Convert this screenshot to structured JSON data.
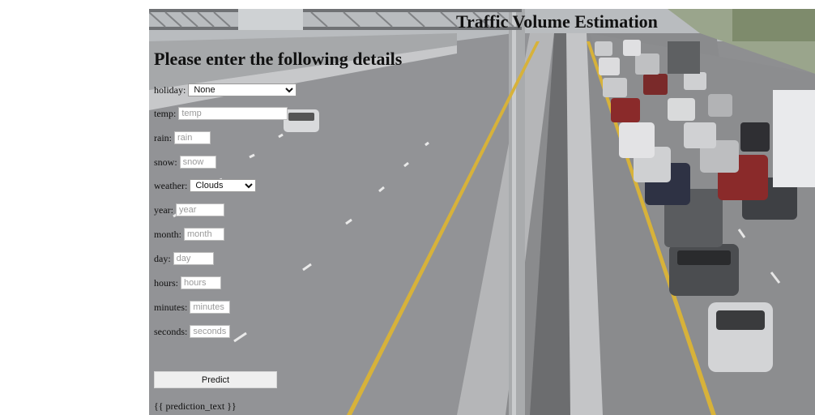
{
  "title": "Traffic Volume Estimation",
  "heading": "Please enter the following details",
  "fields": {
    "holiday": {
      "label": "holiday:",
      "selected": "None"
    },
    "temp": {
      "label": "temp:",
      "placeholder": "temp"
    },
    "rain": {
      "label": "rain:",
      "placeholder": "rain"
    },
    "snow": {
      "label": "snow:",
      "placeholder": "snow"
    },
    "weather": {
      "label": "weather:",
      "selected": "Clouds"
    },
    "year": {
      "label": "year:",
      "placeholder": "year"
    },
    "month": {
      "label": "month:",
      "placeholder": "month"
    },
    "day": {
      "label": "day:",
      "placeholder": "day"
    },
    "hours": {
      "label": "hours:",
      "placeholder": "hours"
    },
    "minutes": {
      "label": "minutes:",
      "placeholder": "minutes"
    },
    "seconds": {
      "label": "seconds:",
      "placeholder": "seconds"
    }
  },
  "predict_label": "Predict",
  "prediction_text": "{{ prediction_text }}"
}
